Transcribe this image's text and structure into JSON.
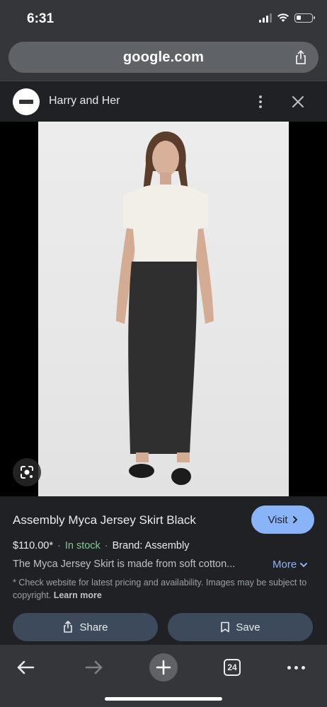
{
  "status_bar": {
    "time": "6:31"
  },
  "browser": {
    "url": "google.com"
  },
  "source": {
    "name": "Harry and Her"
  },
  "product": {
    "title": "Assembly Myca Jersey Skirt Black",
    "visit_label": "Visit",
    "price": "$110.00*",
    "stock": "In stock",
    "brand": "Brand: Assembly",
    "description": "The Myca Jersey Skirt is made from soft cotton...",
    "more_label": "More",
    "disclaimer": "* Check website for latest pricing and availability. Images may be subject to copyright.",
    "learn_more": "Learn more",
    "share_label": "Share",
    "save_label": "Save"
  },
  "toolbar": {
    "tab_count": "24"
  },
  "colors": {
    "accent": "#8ab4f8",
    "in_stock": "#81c995",
    "button_bg": "#3c4a5c"
  }
}
